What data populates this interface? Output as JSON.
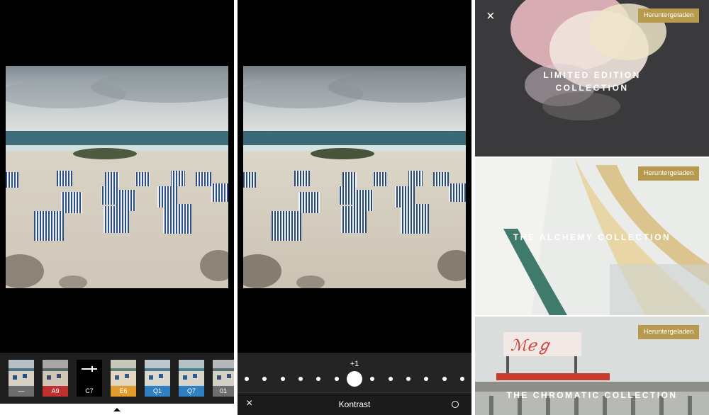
{
  "panel1": {
    "filters": [
      {
        "label": "—",
        "color": "#6d6d6d"
      },
      {
        "label": "A9",
        "color": "#c0302e"
      },
      {
        "label": "C7",
        "color": "#000000"
      },
      {
        "label": "E6",
        "color": "#e39b2b"
      },
      {
        "label": "Q1",
        "color": "#2f7fc1"
      },
      {
        "label": "Q7",
        "color": "#2f7fc1"
      },
      {
        "label": "01",
        "color": "#6d6d6d"
      }
    ]
  },
  "panel2": {
    "adjust_value": "+1",
    "adjust_title": "Kontrast",
    "cancel_symbol": "×",
    "slider_position": 0.5
  },
  "panel3": {
    "close_symbol": "×",
    "collections": [
      {
        "title_line1": "LIMITED EDITION",
        "title_line2": "COLLECTION",
        "badge": "Heruntergeladen"
      },
      {
        "title_line1": "THE ALCHEMY COLLECTION",
        "badge": "Heruntergeladen"
      },
      {
        "title_line1": "THE CHROMATIC COLLECTION",
        "badge": "Heruntergeladen"
      }
    ]
  },
  "colors": {
    "badge_gold": "#b89a4e",
    "dark_bg": "#000000",
    "strip_bg": "#1e1e1e"
  }
}
